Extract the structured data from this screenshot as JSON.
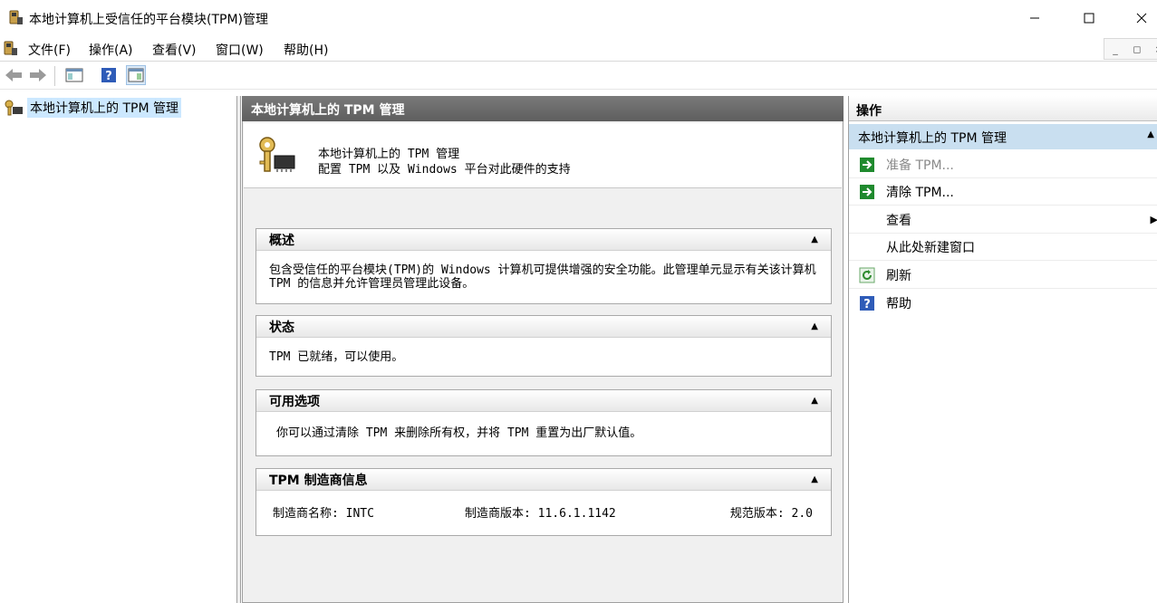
{
  "window": {
    "title": "本地计算机上受信任的平台模块(TPM)管理"
  },
  "menubar": {
    "items": [
      "文件(F)",
      "操作(A)",
      "查看(V)",
      "窗口(W)",
      "帮助(H)"
    ]
  },
  "tree": {
    "root_label": "本地计算机上的 TPM 管理"
  },
  "center": {
    "header": "本地计算机上的 TPM 管理",
    "intro_line1": "本地计算机上的 TPM 管理",
    "intro_line2": "配置 TPM 以及 Windows 平台对此硬件的支持",
    "overview": {
      "title": "概述",
      "text": "包含受信任的平台模块(TPM)的 Windows 计算机可提供增强的安全功能。此管理单元显示有关该计算机 TPM 的信息并允许管理员管理此设备。"
    },
    "status": {
      "title": "状态",
      "text": "TPM 已就绪，可以使用。"
    },
    "options": {
      "title": "可用选项",
      "text": "你可以通过清除 TPM 来删除所有权，并将 TPM 重置为出厂默认值。"
    },
    "manufacturer": {
      "title": "TPM 制造商信息",
      "name": "制造商名称: INTC",
      "version": "制造商版本: 11.6.1.1142",
      "spec": "规范版本: 2.0"
    }
  },
  "actions": {
    "header": "操作",
    "group": "本地计算机上的 TPM 管理",
    "items": [
      {
        "label": "准备 TPM...",
        "icon": "green-arrow-icon",
        "disabled": true
      },
      {
        "label": "清除 TPM...",
        "icon": "green-arrow-icon",
        "disabled": false
      },
      {
        "label": "查看",
        "icon": "",
        "disabled": false
      },
      {
        "label": "从此处新建窗口",
        "icon": "",
        "disabled": false
      },
      {
        "label": "刷新",
        "icon": "refresh-icon",
        "disabled": false
      },
      {
        "label": "帮助",
        "icon": "help-icon",
        "disabled": false
      }
    ]
  },
  "colors": {
    "selection": "#cce8ff",
    "center_header": "#6b6b6b",
    "actions_group": "#c9dff0",
    "action_green": "#1f8a2e",
    "help_blue": "#2f5cb8"
  }
}
